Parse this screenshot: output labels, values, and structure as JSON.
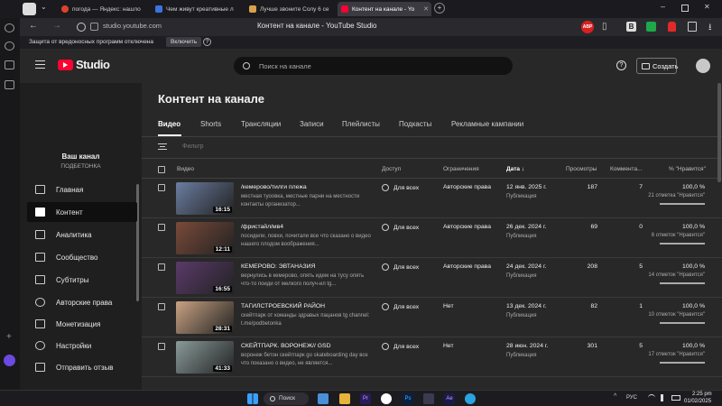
{
  "browser": {
    "tabs": [
      {
        "label": "погода — Яндекс: нашло",
        "color": "#e0412c"
      },
      {
        "label": "Чем живут креативные л",
        "color": "#3a74e0"
      },
      {
        "label": "Лучше звоните Солу 6 се",
        "color": "#d9a14a"
      },
      {
        "label": "Контент на канале - Yo",
        "color": "#ff0033"
      }
    ],
    "url": "studio.youtube.com",
    "page_title": "Контент на канале - YouTube Studio",
    "protection_text": "Защита от вредоносных программ отключена",
    "protection_button": "Включить",
    "protection_help": "?"
  },
  "header": {
    "logo": "Studio",
    "search_placeholder": "Поиск на канале",
    "help": "?",
    "create_label": "Создать"
  },
  "channel": {
    "title": "Ваш канал",
    "name": "ПОДБЕТОНКА"
  },
  "nav": [
    {
      "label": "Главная",
      "icon": "dashboard-icon"
    },
    {
      "label": "Контент",
      "icon": "content-icon",
      "selected": true
    },
    {
      "label": "Аналитика",
      "icon": "analytics-icon"
    },
    {
      "label": "Сообщество",
      "icon": "community-icon"
    },
    {
      "label": "Субтитры",
      "icon": "subtitles-icon"
    },
    {
      "label": "Авторские права",
      "icon": "copyright-icon"
    },
    {
      "label": "Монетизация",
      "icon": "monetization-icon"
    },
    {
      "label": "Настройки",
      "icon": "gear-icon"
    },
    {
      "label": "Отправить отзыв",
      "icon": "feedback-icon"
    }
  ],
  "main": {
    "title": "Контент на канале",
    "tabs": [
      "Видео",
      "Shorts",
      "Трансляции",
      "Записи",
      "Плейлисты",
      "Подкасты",
      "Рекламные кампании"
    ],
    "filter_placeholder": "Фильтр",
    "columns": {
      "video": "Видео",
      "access": "Доступ",
      "restrictions": "Ограничения",
      "date": "Дата",
      "views": "Просмотры",
      "comments": "Коммента...",
      "likes": "% \"Нравится\""
    },
    "rows": [
      {
        "title": "/кемерово/тилги плежа",
        "desc": "местная туоовка, местные парни на местности контакты организатор...",
        "duration": "16:15",
        "access": "Для всех",
        "restrictions": "Авторские права",
        "date": "12 янв. 2025 г.",
        "date_sub": "Публикация",
        "views": "187",
        "comments": "7",
        "likes": "100,0 %",
        "likes_sub": "21 отметка \"Нравится\"",
        "thumb": "#6b7da0"
      },
      {
        "title": "/фристайл/мв4",
        "desc": "посидели, повхи, почитали все что сказано о видео нашего плодом воображения...",
        "duration": "12:11",
        "access": "Для всех",
        "restrictions": "Авторские права",
        "date": "26 дек. 2024 г.",
        "date_sub": "Публикация",
        "views": "69",
        "comments": "0",
        "likes": "100,0 %",
        "likes_sub": "6 отметок \"Нравится\"",
        "thumb": "#7a4a3a"
      },
      {
        "title": "КЕМЕРОВО: ЭВТАНАЗИЯ",
        "desc": "вернулись в кемерово, опять идем на тусу опять что-то поиди от мелкого получ-ил tg...",
        "duration": "16:55",
        "access": "Для всех",
        "restrictions": "Авторские права",
        "date": "24 дек. 2024 г.",
        "date_sub": "Публикация",
        "views": "208",
        "comments": "5",
        "likes": "100,0 %",
        "likes_sub": "14 отметок \"Нравится\"",
        "thumb": "#5a3a6a"
      },
      {
        "title": "ТАГИЛСТРОЕВСКИЙ РАЙОН",
        "desc": "скейтпарк от команды здравых пацанов tg channel: t.me/podbetonka",
        "duration": "28:31",
        "access": "Для всех",
        "restrictions": "Нет",
        "date": "13 дек. 2024 г.",
        "date_sub": "Публикация",
        "views": "82",
        "comments": "1",
        "likes": "100,0 %",
        "likes_sub": "10 отметок \"Нравится\"",
        "thumb": "#c9a283"
      },
      {
        "title": "СКЕЙТПАРК. ВОРОНЕЖ// GSD",
        "desc": "воронеж бетон скейтпарк go skateboarding day все что показано о видео, не является...",
        "duration": "41:33",
        "access": "Для всех",
        "restrictions": "Нет",
        "date": "28 июн. 2024 г.",
        "date_sub": "Публикация",
        "views": "301",
        "comments": "5",
        "likes": "100,0 %",
        "likes_sub": "17 отметок \"Нравится\"",
        "thumb": "#8a9a9a"
      }
    ]
  },
  "taskbar": {
    "search_label": "Поиск",
    "lang": "РУС",
    "time": "2:25 pm",
    "date": "01/02/2025"
  }
}
